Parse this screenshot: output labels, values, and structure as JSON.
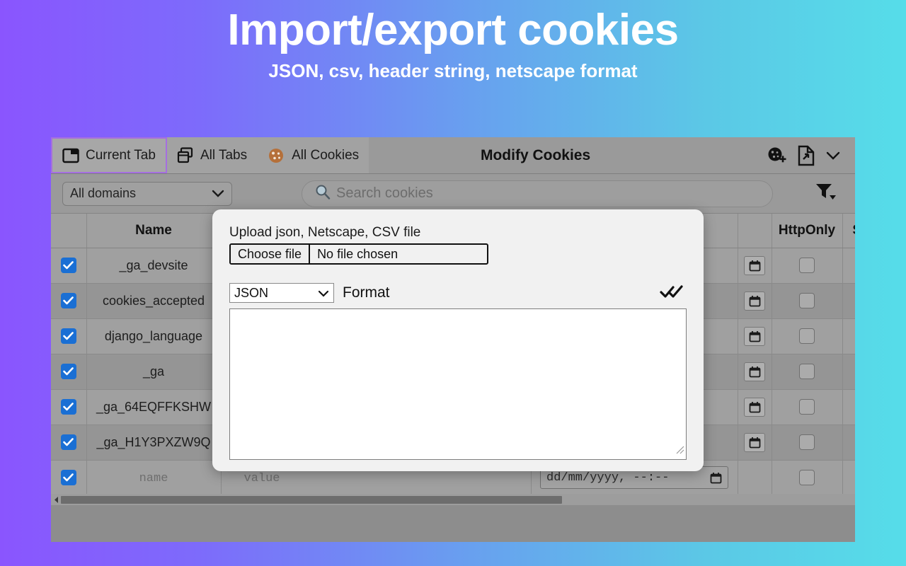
{
  "banner": {
    "title": "Import/export cookies",
    "subtitle": "JSON, csv, header string, netscape format",
    "gradient_from": "#8a55fe",
    "gradient_to": "#56dde9"
  },
  "topbar": {
    "tabs": [
      {
        "label": "Current Tab",
        "icon": "window-icon",
        "active": true
      },
      {
        "label": "All Tabs",
        "icon": "tabs-stack-icon",
        "active": false
      },
      {
        "label": "All Cookies",
        "icon": "cookie-icon",
        "active": false
      }
    ],
    "title": "Modify Cookies",
    "actions": [
      {
        "name": "add-cookie-icon",
        "label": "Add cookie"
      },
      {
        "name": "export-file-icon",
        "label": "Export"
      },
      {
        "name": "chevron-down-icon",
        "label": "Export options"
      }
    ],
    "active_tab_border": "#a56fe0"
  },
  "filterbar": {
    "domain_select": {
      "value": "All domains",
      "options": [
        "All domains"
      ]
    },
    "search": {
      "value": "",
      "placeholder": "Search cookies",
      "icon": "search-icon"
    },
    "filter_icon": "filter-funnel-icon"
  },
  "table": {
    "columns": [
      {
        "key": "select",
        "label": ""
      },
      {
        "key": "name",
        "label": "Name"
      },
      {
        "key": "value",
        "label": ""
      },
      {
        "key": "expiry",
        "label": ""
      },
      {
        "key": "calendar",
        "label": ""
      },
      {
        "key": "httponly",
        "label": "HttpOnly"
      },
      {
        "key": "secure",
        "label": "Secure"
      }
    ],
    "rows": [
      {
        "selected": true,
        "name": "_ga_devsite",
        "value": "",
        "expiry": "",
        "httponly": false,
        "secure": false
      },
      {
        "selected": true,
        "name": "cookies_accepted",
        "value": "",
        "expiry": "",
        "httponly": false,
        "secure": false
      },
      {
        "selected": true,
        "name": "django_language",
        "value": "",
        "expiry": "",
        "httponly": false,
        "secure": false
      },
      {
        "selected": true,
        "name": "_ga",
        "value": "",
        "expiry": "",
        "httponly": false,
        "secure": false
      },
      {
        "selected": true,
        "name": "_ga_64EQFFKSHW",
        "value": "",
        "expiry": "",
        "httponly": false,
        "secure": false
      },
      {
        "selected": true,
        "name": "_ga_H1Y3PXZW9Q",
        "value": "",
        "expiry": "",
        "httponly": false,
        "secure": false
      }
    ],
    "new_row": {
      "selected": true,
      "name_placeholder": "name",
      "value_placeholder": "value",
      "date_placeholder": "dd/mm/yyyy, --:--",
      "httponly": false,
      "secure": false
    },
    "checkbox_color": "#1a6fd4"
  },
  "modal": {
    "upload_label": "Upload json, Netscape, CSV file",
    "choose_file_button": "Choose file",
    "file_status": "No file chosen",
    "format_select": {
      "value": "JSON",
      "options": [
        "JSON"
      ]
    },
    "format_label": "Format",
    "apply_icon": "double-check-icon",
    "textarea_value": "",
    "textarea_placeholder": ""
  },
  "scrollbar": {
    "orientation": "horizontal",
    "arrow_icon": "chevron-left-icon"
  }
}
